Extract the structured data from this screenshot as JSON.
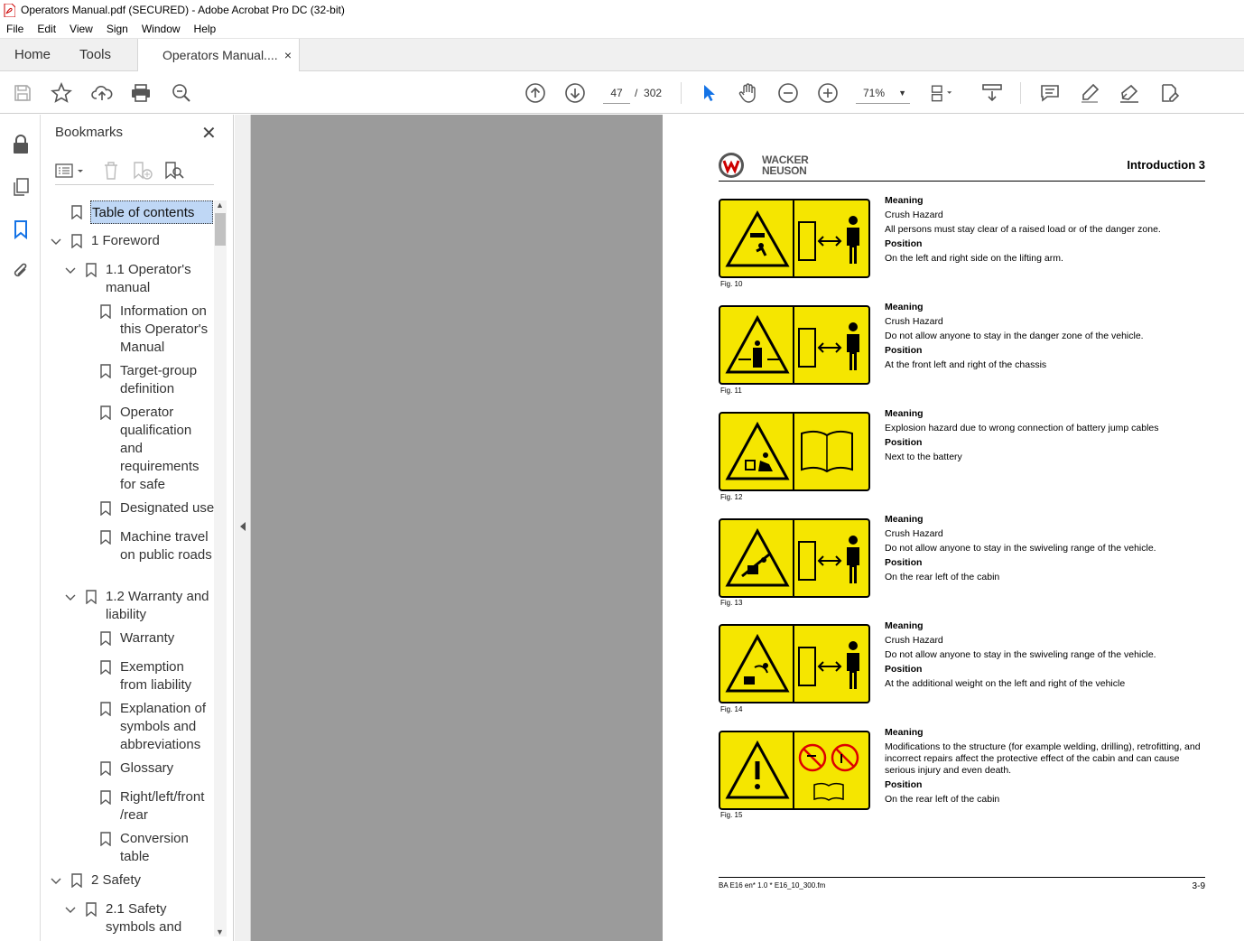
{
  "window": {
    "title": "Operators Manual.pdf (SECURED) - Adobe Acrobat Pro DC (32-bit)"
  },
  "menu": [
    "File",
    "Edit",
    "View",
    "Sign",
    "Window",
    "Help"
  ],
  "tabs": {
    "home": "Home",
    "tools": "Tools",
    "doc": "Operators Manual....",
    "close": "×"
  },
  "toolbar": {
    "page_current": "47",
    "page_sep": "/",
    "page_total": "302",
    "zoom": "71%"
  },
  "bookmarks": {
    "title": "Bookmarks",
    "close": "✕",
    "items": [
      {
        "label": "Table of contents",
        "level": 0,
        "chev": ""
      },
      {
        "label": "1 Foreword",
        "level": 0,
        "chev": "v"
      },
      {
        "label": "1.1 Operator's manual",
        "level": 1,
        "chev": "v"
      },
      {
        "label": "Information on this Operator's Manual",
        "level": 2,
        "chev": ""
      },
      {
        "label": "Target-group definition",
        "level": 2,
        "chev": ""
      },
      {
        "label": "Operator qualification and requirements for safe",
        "level": 2,
        "chev": ""
      },
      {
        "label": "Designated use",
        "level": 2,
        "chev": ""
      },
      {
        "label": "Machine travel on public roads",
        "level": 2,
        "chev": ""
      },
      {
        "label": "1.2 Warranty and liability",
        "level": 1,
        "chev": "v"
      },
      {
        "label": "Warranty",
        "level": 2,
        "chev": ""
      },
      {
        "label": "Exemption from liability",
        "level": 2,
        "chev": ""
      },
      {
        "label": "Explanation of symbols and abbreviations",
        "level": 2,
        "chev": ""
      },
      {
        "label": "Glossary",
        "level": 2,
        "chev": ""
      },
      {
        "label": "Right/left/front /rear",
        "level": 2,
        "chev": ""
      },
      {
        "label": "Conversion table",
        "level": 2,
        "chev": ""
      },
      {
        "label": "2 Safety",
        "level": 0,
        "chev": "v"
      },
      {
        "label": "2.1 Safety symbols and",
        "level": 1,
        "chev": "v"
      }
    ]
  },
  "page": {
    "logo": "WACKER NEUSON",
    "header": "Introduction  3",
    "signs": [
      {
        "fig": "Fig. 10",
        "meaning_h": "Meaning",
        "meaning": "Crush Hazard",
        "extra": "All persons must stay clear of a raised load or of the danger zone.",
        "position_h": "Position",
        "position": "On the left and right side on the lifting arm."
      },
      {
        "fig": "Fig. 11",
        "meaning_h": "Meaning",
        "meaning": "Crush Hazard",
        "extra": "Do not allow anyone to stay in the danger zone of the vehicle.",
        "position_h": "Position",
        "position": "At the front left and right of the chassis"
      },
      {
        "fig": "Fig. 12",
        "meaning_h": "Meaning",
        "meaning": "Explosion hazard due to wrong connection of battery jump cables",
        "extra": "",
        "position_h": "Position",
        "position": "Next to the battery"
      },
      {
        "fig": "Fig. 13",
        "meaning_h": "Meaning",
        "meaning": "Crush Hazard",
        "extra": "Do not allow anyone to stay in the swiveling range of the vehicle.",
        "position_h": "Position",
        "position": "On the rear left of the cabin"
      },
      {
        "fig": "Fig. 14",
        "meaning_h": "Meaning",
        "meaning": "Crush Hazard",
        "extra": "Do not allow anyone to stay in the swiveling range of the vehicle.",
        "position_h": "Position",
        "position": "At the additional weight on the left and right of the vehicle"
      },
      {
        "fig": "Fig. 15",
        "meaning_h": "Meaning",
        "meaning": "Modifications to the structure (for example welding, drilling), retrofitting, and incorrect repairs affect the protective effect of the cabin and can cause serious injury and even death.",
        "extra": "",
        "position_h": "Position",
        "position": "On the rear left of the cabin"
      }
    ],
    "footer_left": "BA E16 en* 1.0 * E16_10_300.fm",
    "footer_right": "3-9"
  }
}
